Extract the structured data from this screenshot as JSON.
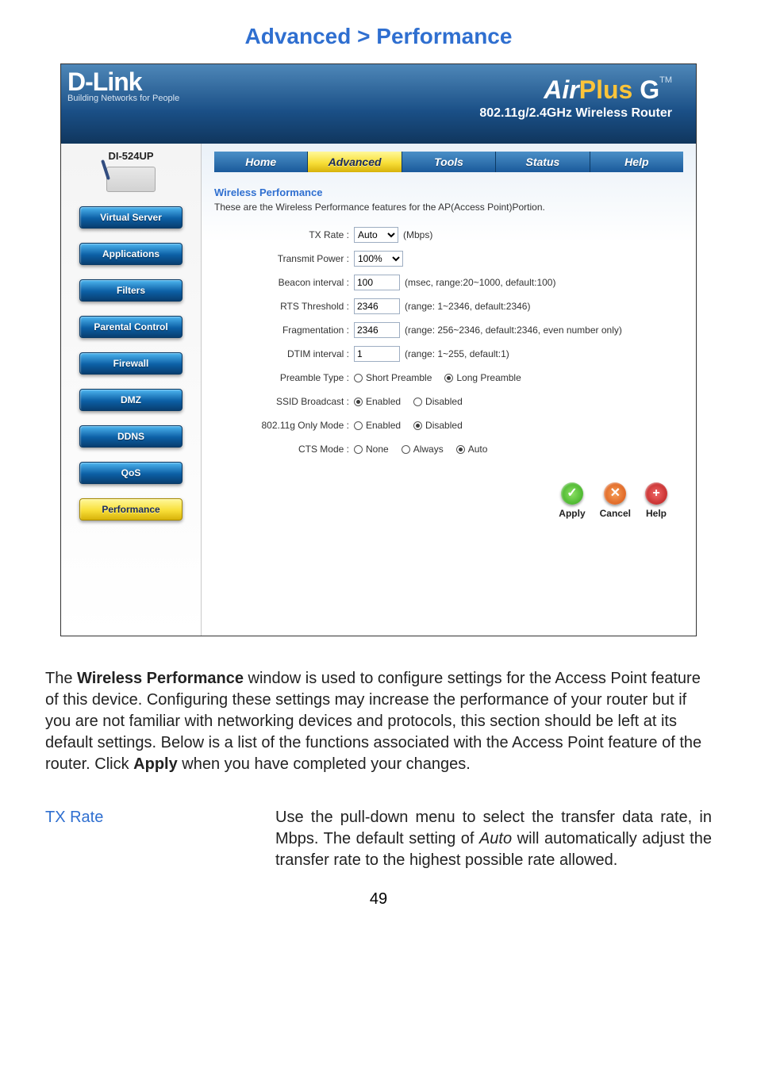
{
  "page_title": "Advanced > Performance",
  "banner": {
    "brand": "D-Link",
    "tag": "Building Networks for People",
    "airplus_air": "Air",
    "airplus_plus": "Plus",
    "airplus_g": " G",
    "airplus_tm": "TM",
    "airplus_sub": "802.11g/2.4GHz Wireless Router"
  },
  "sidebar": {
    "model": "DI-524UP",
    "items": [
      {
        "label": "Virtual Server",
        "active": false
      },
      {
        "label": "Applications",
        "active": false
      },
      {
        "label": "Filters",
        "active": false
      },
      {
        "label": "Parental Control",
        "active": false
      },
      {
        "label": "Firewall",
        "active": false
      },
      {
        "label": "DMZ",
        "active": false
      },
      {
        "label": "DDNS",
        "active": false
      },
      {
        "label": "QoS",
        "active": false
      },
      {
        "label": "Performance",
        "active": true
      }
    ]
  },
  "tabs": [
    {
      "label": "Home",
      "active": false
    },
    {
      "label": "Advanced",
      "active": true
    },
    {
      "label": "Tools",
      "active": false
    },
    {
      "label": "Status",
      "active": false
    },
    {
      "label": "Help",
      "active": false
    }
  ],
  "section": {
    "title": "Wireless Performance",
    "desc": "These are the Wireless Performance features for the AP(Access Point)Portion."
  },
  "form": {
    "tx_rate": {
      "label": "TX Rate :",
      "value": "Auto",
      "unit": "(Mbps)"
    },
    "transmit_power": {
      "label": "Transmit Power :",
      "value": "100%"
    },
    "beacon": {
      "label": "Beacon interval :",
      "value": "100",
      "hint": "(msec, range:20~1000, default:100)"
    },
    "rts": {
      "label": "RTS Threshold :",
      "value": "2346",
      "hint": "(range: 1~2346, default:2346)"
    },
    "frag": {
      "label": "Fragmentation :",
      "value": "2346",
      "hint": "(range: 256~2346, default:2346, even number only)"
    },
    "dtim": {
      "label": "DTIM interval :",
      "value": "1",
      "hint": "(range: 1~255, default:1)"
    },
    "preamble": {
      "label": "Preamble Type :",
      "opts": [
        "Short Preamble",
        "Long Preamble"
      ],
      "selected": 1
    },
    "ssid": {
      "label": "SSID Broadcast :",
      "opts": [
        "Enabled",
        "Disabled"
      ],
      "selected": 0
    },
    "gonly": {
      "label": "802.11g Only Mode :",
      "opts": [
        "Enabled",
        "Disabled"
      ],
      "selected": 1
    },
    "cts": {
      "label": "CTS Mode :",
      "opts": [
        "None",
        "Always",
        "Auto"
      ],
      "selected": 2
    }
  },
  "actions": {
    "apply": "Apply",
    "cancel": "Cancel",
    "help": "Help"
  },
  "explain": {
    "p1a": "The ",
    "p1b": "Wireless Performance",
    "p1c": " window is used to configure settings for the Access Point feature of this device. Configuring these settings may increase the performance of your router but if you are not familiar with networking devices and protocols, this section should be left at its default settings. Below is a list of the functions associated with the Access Point feature of the router. Click ",
    "p1d": "Apply",
    "p1e": " when you have completed your changes."
  },
  "param": {
    "label": "TX Rate",
    "desc_a": "Use the pull-down menu to select the transfer data rate, in Mbps. The default setting of ",
    "desc_b": "Auto",
    "desc_c": " will automatically adjust the transfer rate to the highest possible rate allowed."
  },
  "page_number": "49"
}
